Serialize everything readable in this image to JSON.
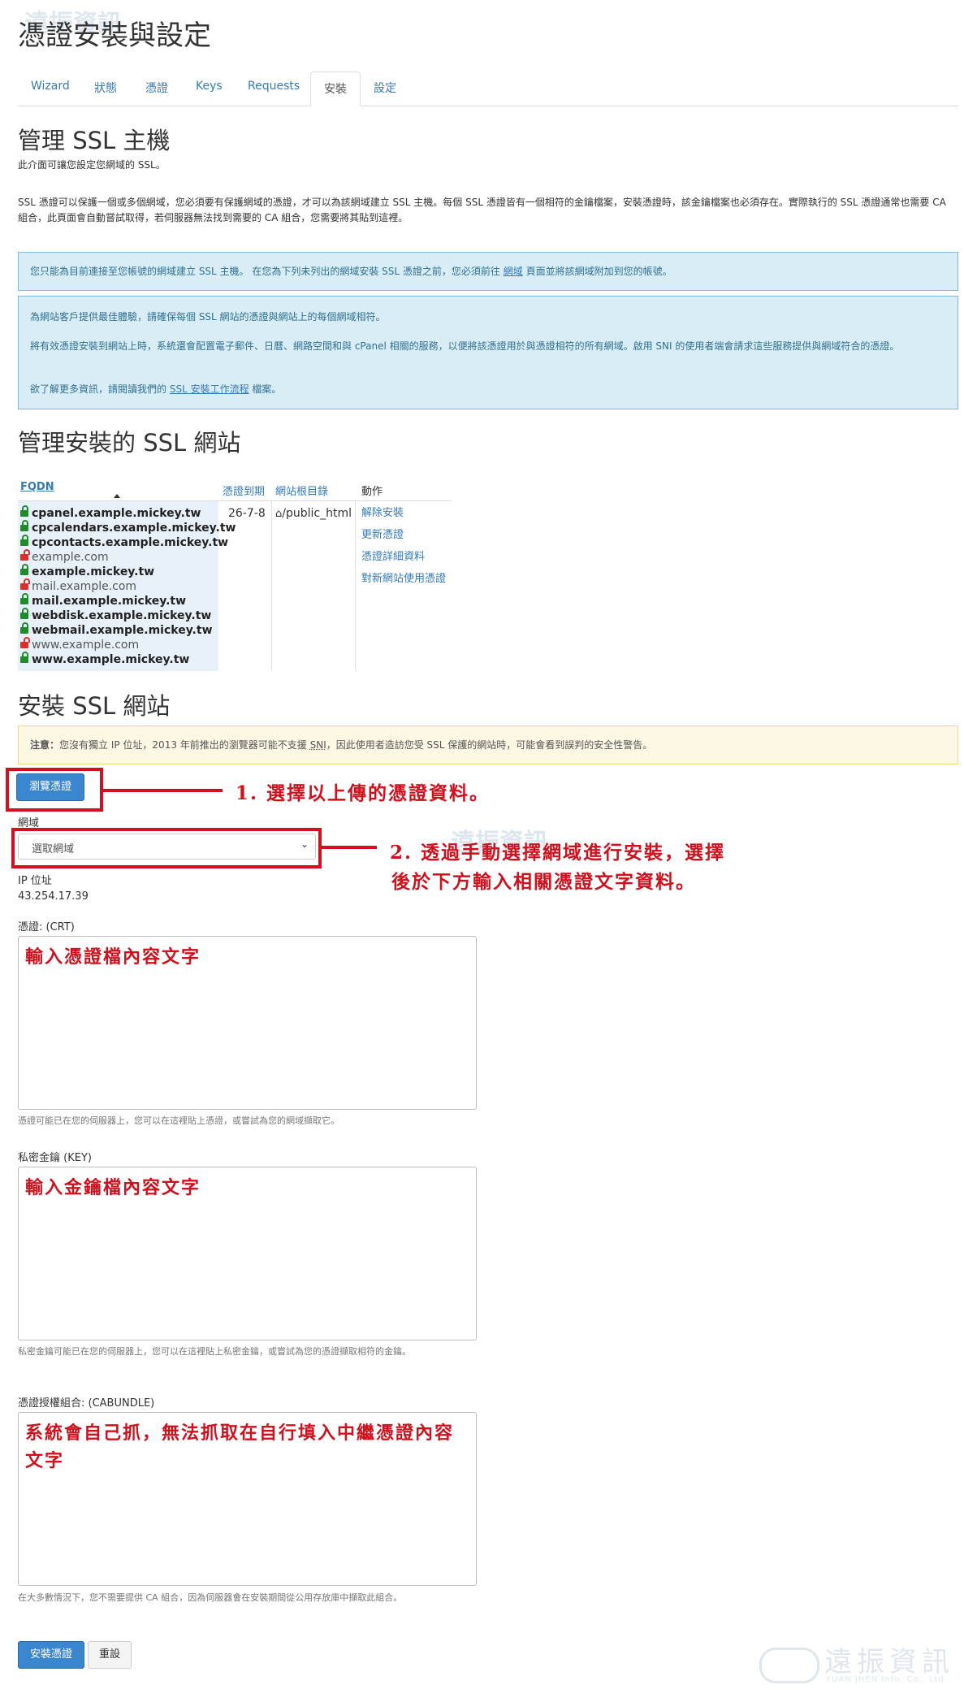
{
  "page_title": "憑證安裝與設定",
  "tabs": [
    "Wizard",
    "狀態",
    "憑證",
    "Keys",
    "Requests",
    "安裝",
    "設定"
  ],
  "manage_host": {
    "heading": "管理 SSL 主機",
    "intro": "此介面可讓您設定您網域的 SSL。",
    "desc": "SSL 憑證可以保護一個或多個網域，您必須要有保護網域的憑證，才可以為該網域建立 SSL 主機。每個 SSL 憑證皆有一個相符的金鑰檔案，安裝憑證時，該金鑰檔案也必須存在。實際執行的 SSL 憑證通常也需要 CA 組合，此頁面會自動嘗試取得，若伺服器無法找到需要的 CA 組合，您需要將其貼到這裡。"
  },
  "info_box1": {
    "text_before": "您只能為目前連接至您帳號的網域建立 SSL 主機。 在您為下列未列出的網域安裝 SSL 憑證之前，您必須前往",
    "link": "網域",
    "text_after": "頁面並將該網域附加到您的帳號。"
  },
  "info_box2": {
    "p1": "為網站客戶提供最佳體驗，請確保每個 SSL 網站的憑證與網站上的每個網域相符。",
    "p2": "將有效憑證安裝到網站上時，系統還會配置電子郵件、日曆、網路空間和與 cPanel 相關的服務，以便將該憑證用於與憑證相符的所有網域。啟用 SNI 的使用者端會請求這些服務提供與網域符合的憑證。",
    "p3_before": "欲了解更多資訊，請閱讀我們的",
    "p3_link": "SSL 安裝工作流程",
    "p3_after": "檔案。"
  },
  "installed": {
    "heading": "管理安裝的 SSL 網站",
    "columns": [
      "FQDN",
      "憑證到期",
      "網站根目錄",
      "動作"
    ],
    "domains": [
      {
        "name": "cpanel.example.mickey.tw",
        "secure": true
      },
      {
        "name": "cpcalendars.example.mickey.tw",
        "secure": true
      },
      {
        "name": "cpcontacts.example.mickey.tw",
        "secure": true
      },
      {
        "name": "example.com",
        "secure": false
      },
      {
        "name": "example.mickey.tw",
        "secure": true
      },
      {
        "name": "mail.example.com",
        "secure": false
      },
      {
        "name": "mail.example.mickey.tw",
        "secure": true
      },
      {
        "name": "webdisk.example.mickey.tw",
        "secure": true
      },
      {
        "name": "webmail.example.mickey.tw",
        "secure": true
      },
      {
        "name": "www.example.com",
        "secure": false
      },
      {
        "name": "www.example.mickey.tw",
        "secure": true
      }
    ],
    "expiry": "26-7-8",
    "docroot": "/public_html",
    "actions": [
      "解除安裝",
      "更新憑證",
      "憑證詳細資料",
      "對新網站使用憑證"
    ]
  },
  "install": {
    "heading": "安裝 SSL 網站",
    "warning_bold": "注意：",
    "warning_text": "您沒有獨立 IP 位址，2013 年前推出的瀏覽器可能不支援 ",
    "warning_sni": "SNI",
    "warning_after": "，因此使用者造訪您受 SSL 保護的網站時，可能會看到誤判的安全性警告。",
    "browse_button": "瀏覽憑證",
    "domain_label": "網域",
    "domain_select": "選取網域",
    "ip_label": "IP 位址",
    "ip_value": "43.254.17.39",
    "crt_label": "憑證: (CRT)",
    "crt_help": "憑證可能已在您的伺服器上，您可以在這裡貼上憑證，或嘗試為您的網域擷取它。",
    "key_label": "私密金鑰 (KEY)",
    "key_help": "私密金鑰可能已在您的伺服器上，您可以在這裡貼上私密金鑰，或嘗試為您的憑證擷取相符的金鑰。",
    "cab_label": "憑證授權組合: (CABUNDLE)",
    "cab_help": "在大多數情況下，您不需要提供 CA 組合，因為伺服器會在安裝期間從公用存放庫中擷取此組合。",
    "install_button": "安裝憑證",
    "reset_button": "重設"
  },
  "annotations": {
    "a1": "1. 選擇以上傳的憑證資料。",
    "a2_line1": "2. 透過手動選擇網域進行安裝，選擇",
    "a2_line2": "後於下方輸入相關憑證文字資料。",
    "crt_text": "輸入憑證檔內容文字",
    "key_text": "輸入金鑰檔內容文字",
    "cab_text": "系統會自己抓，無法抓取在自行填入中繼憑證內容文字"
  },
  "watermark": {
    "brand": "遠振資訊",
    "sub": "YUAN JHEN Info. Co., Ltd"
  }
}
